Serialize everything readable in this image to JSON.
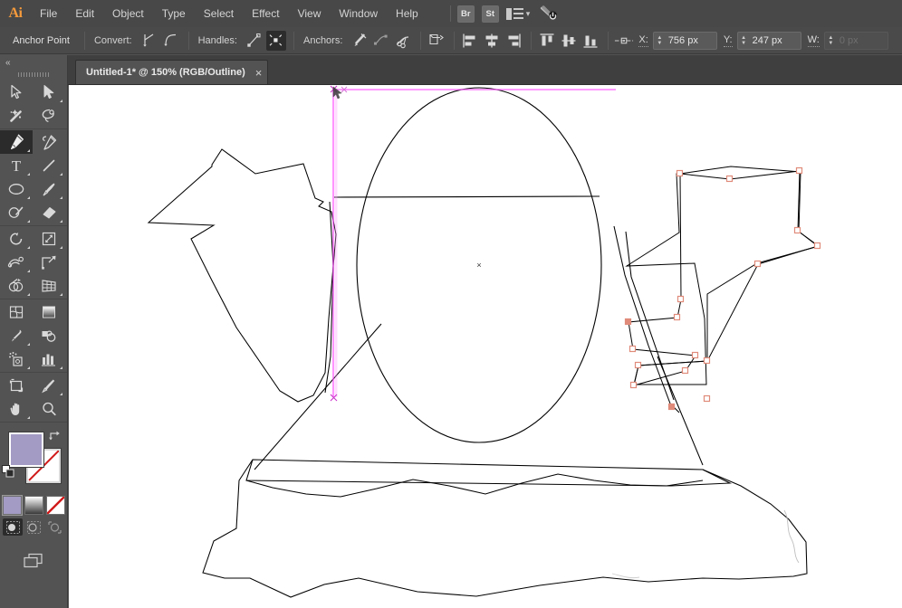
{
  "app": {
    "name": "Adobe Illustrator",
    "logo_text": "Ai"
  },
  "menubar": {
    "items": [
      {
        "label": "File",
        "name": "menu-file"
      },
      {
        "label": "Edit",
        "name": "menu-edit"
      },
      {
        "label": "Object",
        "name": "menu-object"
      },
      {
        "label": "Type",
        "name": "menu-type"
      },
      {
        "label": "Select",
        "name": "menu-select"
      },
      {
        "label": "Effect",
        "name": "menu-effect"
      },
      {
        "label": "View",
        "name": "menu-view"
      },
      {
        "label": "Window",
        "name": "menu-window"
      },
      {
        "label": "Help",
        "name": "menu-help"
      }
    ],
    "bridge_label": "Br",
    "stock_label": "St",
    "workspace_icon": "workspace-switcher-icon",
    "chevron": "▾",
    "search_icon": "search-adobe-stock-icon"
  },
  "controlbar": {
    "tool_title": "Anchor Point",
    "convert_label": "Convert:",
    "handles_label": "Handles:",
    "anchors_label": "Anchors:",
    "convert_to_corner_icon": "convert-to-corner-icon",
    "convert_to_smooth_icon": "convert-to-smooth-icon",
    "show_handles_icon": "show-handles-icon",
    "hide_handles_icon": "hide-handles-icon",
    "remove_anchor_icon": "remove-anchor-icon",
    "connect_anchors_icon": "connect-anchors-icon",
    "cut_path_icon": "cut-path-at-anchor-icon",
    "isolate_icon": "isolate-selected-object-icon",
    "align_left_icon": "align-left-icon",
    "align_center_icon": "align-horizontal-center-icon",
    "align_right_icon": "align-right-icon",
    "align_top_icon": "align-top-icon",
    "align_middle_icon": "align-vertical-center-icon",
    "align_bottom_icon": "align-bottom-icon",
    "transform_icon": "transform-anchor-icon",
    "fields": [
      {
        "label": "X:",
        "value": "756 px",
        "name": "x-position-field",
        "disabled": false
      },
      {
        "label": "Y:",
        "value": "247 px",
        "name": "y-position-field",
        "disabled": false
      },
      {
        "label": "W:",
        "value": "0 px",
        "name": "width-field",
        "disabled": true
      }
    ]
  },
  "tabbar": {
    "tab_title": "Untitled-1* @ 150% (RGB/Outline)",
    "close_glyph": "×",
    "zoom_level": "150%",
    "color_mode": "RGB",
    "view_mode": "Outline",
    "document_name": "Untitled-1*"
  },
  "toolbar": {
    "collapse_glyph": "«",
    "groups": [
      {
        "rows": [
          [
            {
              "name": "tool-selection",
              "label": "Selection",
              "arrow": false,
              "active": false
            },
            {
              "name": "tool-direct-selection",
              "label": "Direct Selection",
              "arrow": true,
              "active": false
            }
          ],
          [
            {
              "name": "tool-magic-wand",
              "label": "Magic Wand",
              "arrow": false,
              "active": false
            },
            {
              "name": "tool-lasso",
              "label": "Lasso",
              "arrow": false,
              "active": false
            }
          ]
        ]
      },
      {
        "rows": [
          [
            {
              "name": "tool-pen",
              "label": "Pen",
              "arrow": true,
              "active": true
            },
            {
              "name": "tool-curvature",
              "label": "Curvature",
              "arrow": false,
              "active": false
            }
          ],
          [
            {
              "name": "tool-type",
              "label": "Type",
              "arrow": true,
              "active": false
            },
            {
              "name": "tool-line-segment",
              "label": "Line Segment",
              "arrow": true,
              "active": false
            }
          ],
          [
            {
              "name": "tool-ellipse",
              "label": "Ellipse",
              "arrow": true,
              "active": false
            },
            {
              "name": "tool-paintbrush",
              "label": "Paintbrush",
              "arrow": true,
              "active": false
            }
          ],
          [
            {
              "name": "tool-shaper",
              "label": "Shaper",
              "arrow": true,
              "active": false
            },
            {
              "name": "tool-eraser",
              "label": "Eraser",
              "arrow": true,
              "active": false
            }
          ]
        ]
      },
      {
        "rows": [
          [
            {
              "name": "tool-rotate",
              "label": "Rotate",
              "arrow": true,
              "active": false
            },
            {
              "name": "tool-scale",
              "label": "Scale",
              "arrow": true,
              "active": false
            }
          ],
          [
            {
              "name": "tool-width",
              "label": "Width",
              "arrow": true,
              "active": false
            },
            {
              "name": "tool-free-transform",
              "label": "Free Transform",
              "arrow": false,
              "active": false
            }
          ],
          [
            {
              "name": "tool-shape-builder",
              "label": "Shape Builder",
              "arrow": true,
              "active": false
            },
            {
              "name": "tool-perspective-grid",
              "label": "Perspective Grid",
              "arrow": true,
              "active": false
            }
          ]
        ]
      },
      {
        "rows": [
          [
            {
              "name": "tool-mesh",
              "label": "Mesh",
              "arrow": false,
              "active": false
            },
            {
              "name": "tool-gradient",
              "label": "Gradient",
              "arrow": false,
              "active": false
            }
          ],
          [
            {
              "name": "tool-eyedropper",
              "label": "Eyedropper",
              "arrow": true,
              "active": false
            },
            {
              "name": "tool-blend",
              "label": "Blend",
              "arrow": false,
              "active": false
            }
          ],
          [
            {
              "name": "tool-symbol-sprayer",
              "label": "Symbol Sprayer",
              "arrow": true,
              "active": false
            },
            {
              "name": "tool-column-graph",
              "label": "Column Graph",
              "arrow": true,
              "active": false
            }
          ]
        ]
      },
      {
        "rows": [
          [
            {
              "name": "tool-artboard",
              "label": "Artboard",
              "arrow": false,
              "active": false
            },
            {
              "name": "tool-slice",
              "label": "Slice",
              "arrow": true,
              "active": false
            }
          ],
          [
            {
              "name": "tool-hand",
              "label": "Hand",
              "arrow": true,
              "active": false
            },
            {
              "name": "tool-zoom",
              "label": "Zoom",
              "arrow": false,
              "active": false
            }
          ]
        ]
      }
    ],
    "fill_color": "#a39bc4",
    "stroke_color": "#ffffff",
    "stroke_is_none": true,
    "fill_label": "Fill",
    "stroke_label": "Stroke",
    "swap_icon": "swap-fill-stroke-icon",
    "default_icon": "default-fill-stroke-icon",
    "modes": [
      {
        "name": "color-mode-button",
        "label": "Color",
        "selected": true
      },
      {
        "name": "gradient-mode-button",
        "label": "Gradient",
        "selected": false
      },
      {
        "name": "none-mode-button",
        "label": "None",
        "selected": false
      }
    ],
    "draw_modes": [
      {
        "name": "draw-normal-button",
        "label": "Draw Normal",
        "selected": true
      },
      {
        "name": "draw-behind-button",
        "label": "Draw Behind",
        "selected": false
      },
      {
        "name": "draw-inside-button",
        "label": "Draw Inside",
        "selected": false
      }
    ],
    "screen_mode": {
      "name": "change-screen-mode-button",
      "label": "Change Screen Mode"
    }
  },
  "canvas": {
    "view_mode": "Outline",
    "background": "#ffffff",
    "path_stroke": "#000000",
    "guide_color": "#ff4dff",
    "anchor_color": "#e08b7a",
    "selected_path_stroke": "#000000",
    "center_mark": "×",
    "description": "Outline-mode vector artwork: large ellipse head, two star/leaf shapes at left and right, layered rocky base shapes below; right-hand star path is selected showing square anchor points; a magenta smart guide runs vertically near the left of the ellipse."
  }
}
